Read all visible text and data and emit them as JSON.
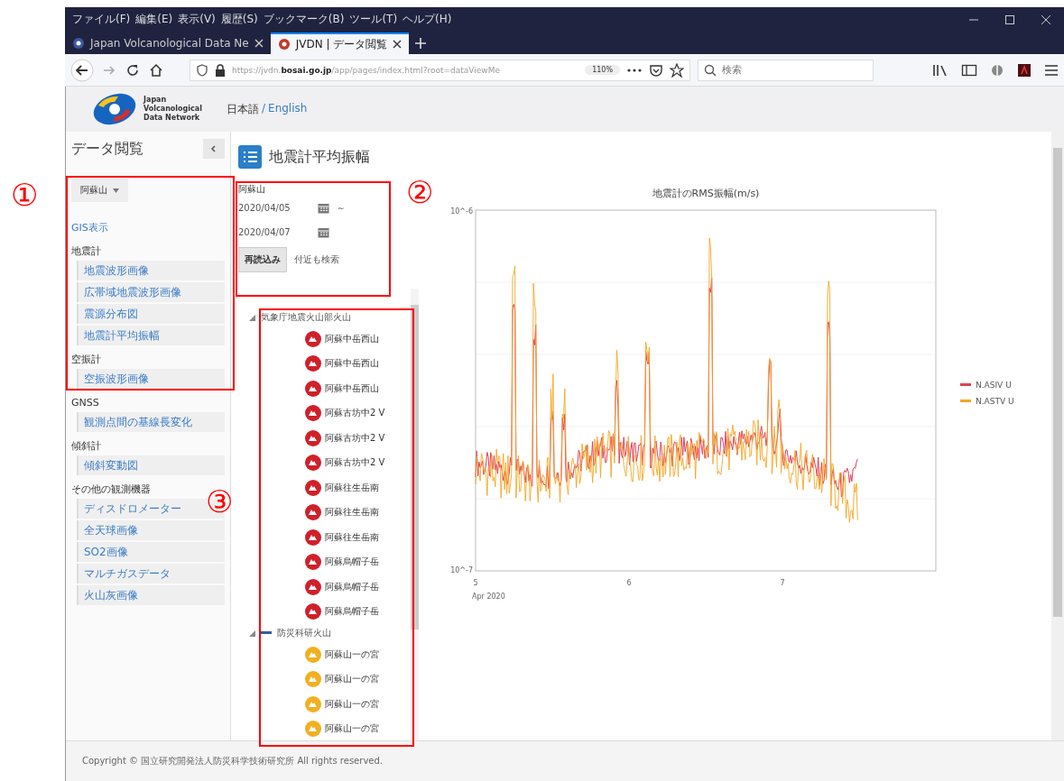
{
  "menu_bar": [
    "ファイル(F)",
    "編集(E)",
    "表示(V)",
    "履歴(S)",
    "ブックマーク(B)",
    "ツール(T)",
    "ヘルプ(H)"
  ],
  "tabs": [
    {
      "label": "Japan Volcanological Data Ne",
      "selected": false
    },
    {
      "label": "JVDN | データ閲覧",
      "selected": true
    }
  ],
  "address_bar": {
    "url": "https://jvdn.**bosai.go.jp**/app/pages/index.html?root=dataViewMe",
    "zoom": "110%"
  },
  "search": {
    "placeholder": "検索"
  },
  "site_header": {
    "logo_text": "Japan Volcanological Data Network",
    "languages": [
      {
        "label": "日本語",
        "selected": true
      },
      {
        "label": "English",
        "selected": false
      }
    ],
    "separator": "/"
  },
  "sidebar": {
    "title": "データ閲覧",
    "volcano": "阿蘇山",
    "gis_link": "GIS表示",
    "groups": [
      {
        "name": "地震計",
        "items": [
          "地震波形画像",
          "広帯域地震波形画像",
          "震源分布図",
          "地震計平均振幅"
        ]
      },
      {
        "name": "空振計",
        "items": [
          "空振波形画像"
        ]
      },
      {
        "name": "GNSS",
        "items": [
          "観測点間の基線長変化"
        ]
      },
      {
        "name": "傾斜計",
        "items": [
          "傾斜変動図"
        ]
      },
      {
        "name": "その他の観測機器",
        "items": [
          "ディスドロメーター",
          "全天球画像",
          "SO2画像",
          "マルチガスデータ",
          "火山灰画像"
        ]
      }
    ]
  },
  "panel": {
    "title": "地震計平均振幅",
    "volcano": "阿蘇山",
    "date_from": "2020/04/05",
    "range_sep": "～",
    "date_to": "2020/04/07",
    "reload_button": "再読込み",
    "nearby_label": "付近も検索"
  },
  "station_tree": [
    {
      "label": "気象庁地震火山部火山",
      "expanded": true,
      "children": [
        {
          "label": "阿蘇中岳西山",
          "color": "#d0202a"
        },
        {
          "label": "阿蘇中岳西山",
          "color": "#d0202a"
        },
        {
          "label": "阿蘇中岳西山",
          "color": "#d0202a"
        },
        {
          "label": "阿蘇古坊中2 V",
          "color": "#d0202a"
        },
        {
          "label": "阿蘇古坊中2 V",
          "color": "#d0202a"
        },
        {
          "label": "阿蘇古坊中2 V",
          "color": "#d0202a"
        },
        {
          "label": "阿蘇往生岳南",
          "color": "#d0202a"
        },
        {
          "label": "阿蘇往生岳南",
          "color": "#d0202a"
        },
        {
          "label": "阿蘇往生岳南",
          "color": "#d0202a"
        },
        {
          "label": "阿蘇烏帽子岳",
          "color": "#d0202a"
        },
        {
          "label": "阿蘇烏帽子岳",
          "color": "#d0202a"
        },
        {
          "label": "阿蘇烏帽子岳",
          "color": "#d0202a"
        }
      ]
    },
    {
      "label": "防災科研火山",
      "expanded": true,
      "children": [
        {
          "label": "阿蘇山一の宮",
          "color": "#f0b020"
        },
        {
          "label": "阿蘇山一の宮",
          "color": "#f0b020"
        },
        {
          "label": "阿蘇山一の宮",
          "color": "#f0b020"
        },
        {
          "label": "阿蘇山一の宮",
          "color": "#f0b020"
        }
      ]
    }
  ],
  "chart": {
    "title": "地震計のRMS振幅(m/s)",
    "yticks": [
      "10^-6",
      "10^-7"
    ],
    "xticks": [
      "5",
      "6",
      "7"
    ],
    "xlabel": "Apr 2020",
    "legend": [
      {
        "name": "N.ASIV U",
        "color": "#e0405a"
      },
      {
        "name": "N.ASTV U",
        "color": "#f5a623"
      }
    ]
  },
  "footer": "Copyright © 国立研究開発法人防災科学技術研究所 All rights reserved.",
  "annotations": [
    {
      "label": "①"
    },
    {
      "label": "②"
    },
    {
      "label": "③"
    }
  ]
}
